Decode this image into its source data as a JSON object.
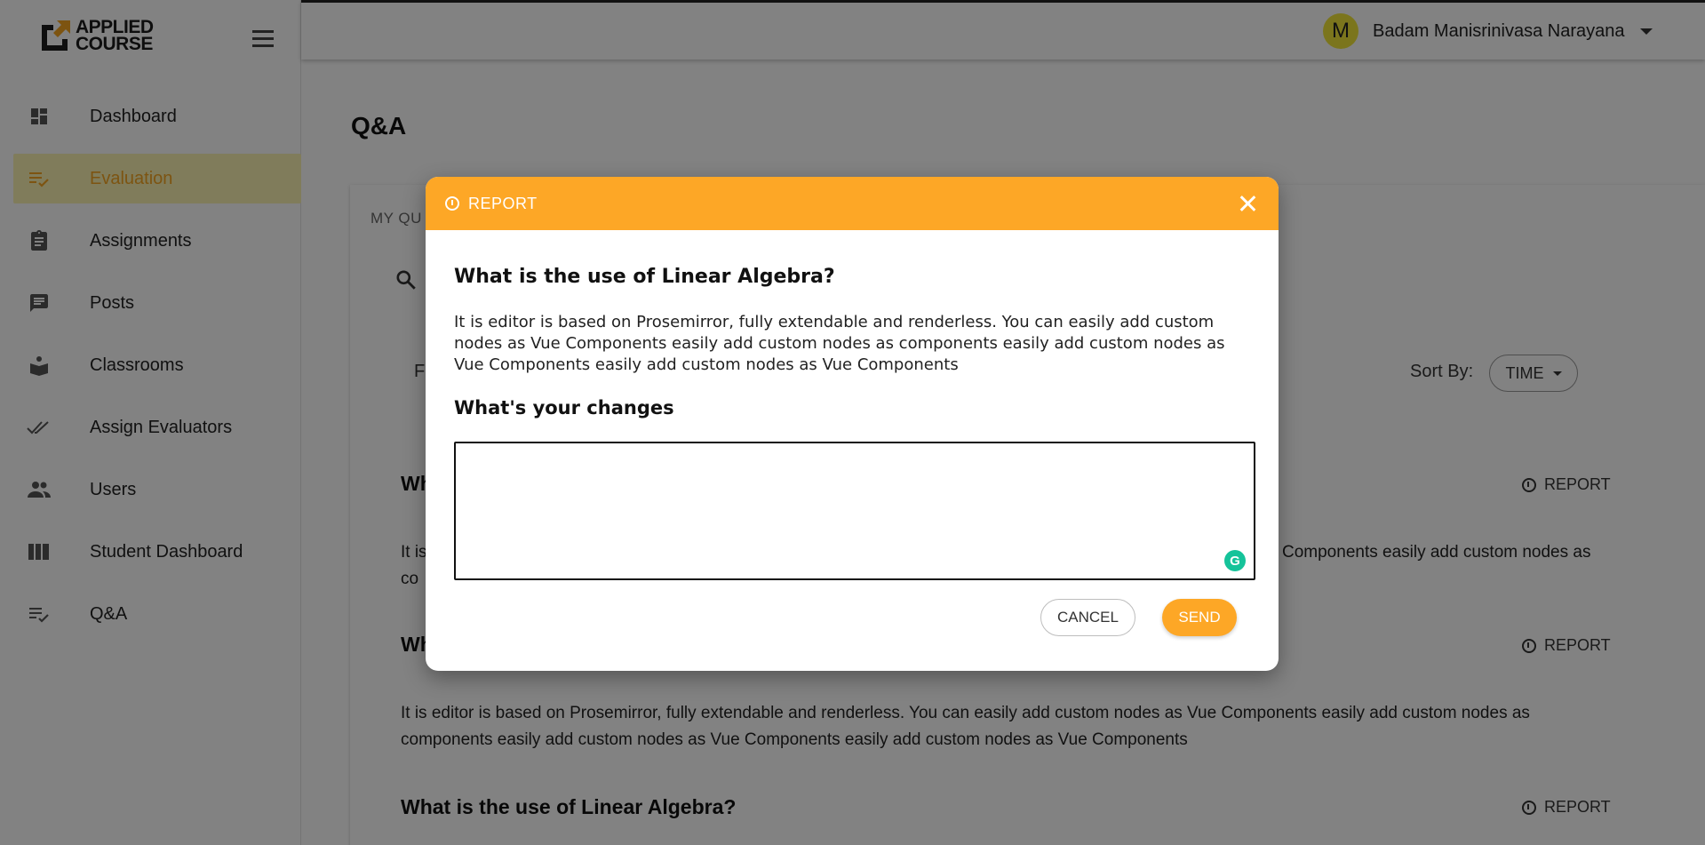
{
  "brand": {
    "line1": "APPLIED",
    "line2": "COURSE"
  },
  "sidebar": {
    "items": [
      {
        "label": "Dashboard",
        "icon": "dashboard-icon",
        "active": false
      },
      {
        "label": "Evaluation",
        "icon": "evaluation-icon",
        "active": true
      },
      {
        "label": "Assignments",
        "icon": "assignment-icon",
        "active": false
      },
      {
        "label": "Posts",
        "icon": "posts-icon",
        "active": false
      },
      {
        "label": "Classrooms",
        "icon": "classroom-icon",
        "active": false
      },
      {
        "label": "Assign Evaluators",
        "icon": "double-check-icon",
        "active": false
      },
      {
        "label": "Users",
        "icon": "users-icon",
        "active": false
      },
      {
        "label": "Student Dashboard",
        "icon": "columns-icon",
        "active": false
      },
      {
        "label": "Q&A",
        "icon": "qa-icon",
        "active": false
      }
    ]
  },
  "topbar": {
    "avatar_letter": "M",
    "username": "Badam Manisrinivasa Narayana"
  },
  "main": {
    "title": "Q&A",
    "tab_partial": "MY QU",
    "filter_partial": "F",
    "sort_label": "Sort By:",
    "sort_value": "TIME",
    "questions": [
      {
        "title_partial": "Wh",
        "report": "REPORT",
        "body_left": "It is",
        "body_left2": "co",
        "body_right": "Components easily add custom nodes as"
      },
      {
        "title_partial": "Wh",
        "report": "REPORT",
        "body": "It is editor is based on Prosemirror, fully extendable and renderless. You can easily add custom nodes as Vue Components easily add custom nodes as components easily add custom nodes as Vue Components easily add custom nodes as Vue Components"
      },
      {
        "title": "What is the use of Linear Algebra?",
        "report": "REPORT"
      }
    ]
  },
  "modal": {
    "header": "REPORT",
    "question": "What is the use of Linear Algebra?",
    "body": "It is editor is based on Prosemirror, fully extendable and renderless. You can easily add custom nodes as Vue Components easily add custom nodes as components easily add custom nodes as Vue Components easily add custom nodes as Vue Components",
    "changes_label": "What's your changes",
    "textarea_value": "",
    "cancel_label": "CANCEL",
    "send_label": "SEND",
    "accent_color": "#fda726"
  }
}
